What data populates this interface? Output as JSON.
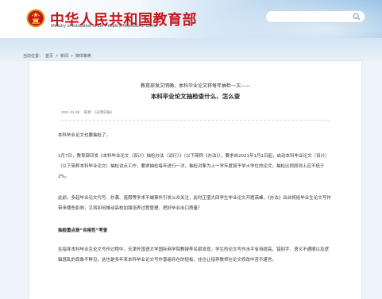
{
  "header": {
    "title_cn": "中华人民共和国教育部",
    "title_en": "Ministry of Education of the People's Republic of China",
    "search": {
      "placeholder": ""
    },
    "colors": {
      "title": "#c8161d",
      "accent": "#9cc4e6"
    }
  },
  "breadcrumb": {
    "prefix": "当前位置：",
    "items": [
      "首页",
      "新闻",
      "媒体聚焦"
    ],
    "separator": ">"
  },
  "article": {
    "pre_title": "教育部发文明确，本科毕业论文将每年抽检一次——",
    "title": "本科毕业论文抽检查什么、怎么查",
    "date": "2021-01-08",
    "source": "来源：《光明日报》",
    "paragraphs": [
      "本科毕业论文也要抽检了。",
      "1月7日，教育部印发《本科毕业论文（设计）抽检办法（试行）》（以下简称《办法》），要求自2021年1月1日起，启动本科毕业论文（设计）（以下简称本科毕业论文）抽检试点工作，要求抽检每年进行一次，抽检对象为上一学年度授予学士学位的论文，抽检比例原则上应不低于2%。",
      "此前，多起毕业论文代写、抄袭、造假等学术不端事件引发公众关注，此时正值大四学生毕业论文开题高峰，《办法》出台将给毕业生论文写作带来哪些影响，又将如何推动高校加强培养过程管理、把好毕业出口质量？",
      "抽检重点是“合格性”考查",
      "在指导本科毕业生论文写作过程中，天津外国语大学国际商学院教授李名梁发现，学生的论文写作水平有待提高，错别字、语义不通顺以及逻辑混乱的现象不鲜见。这也是多年来本科毕业论文写作普遍存在的短板，往往让指导教师在论文修改中苦不堪言。"
    ]
  }
}
